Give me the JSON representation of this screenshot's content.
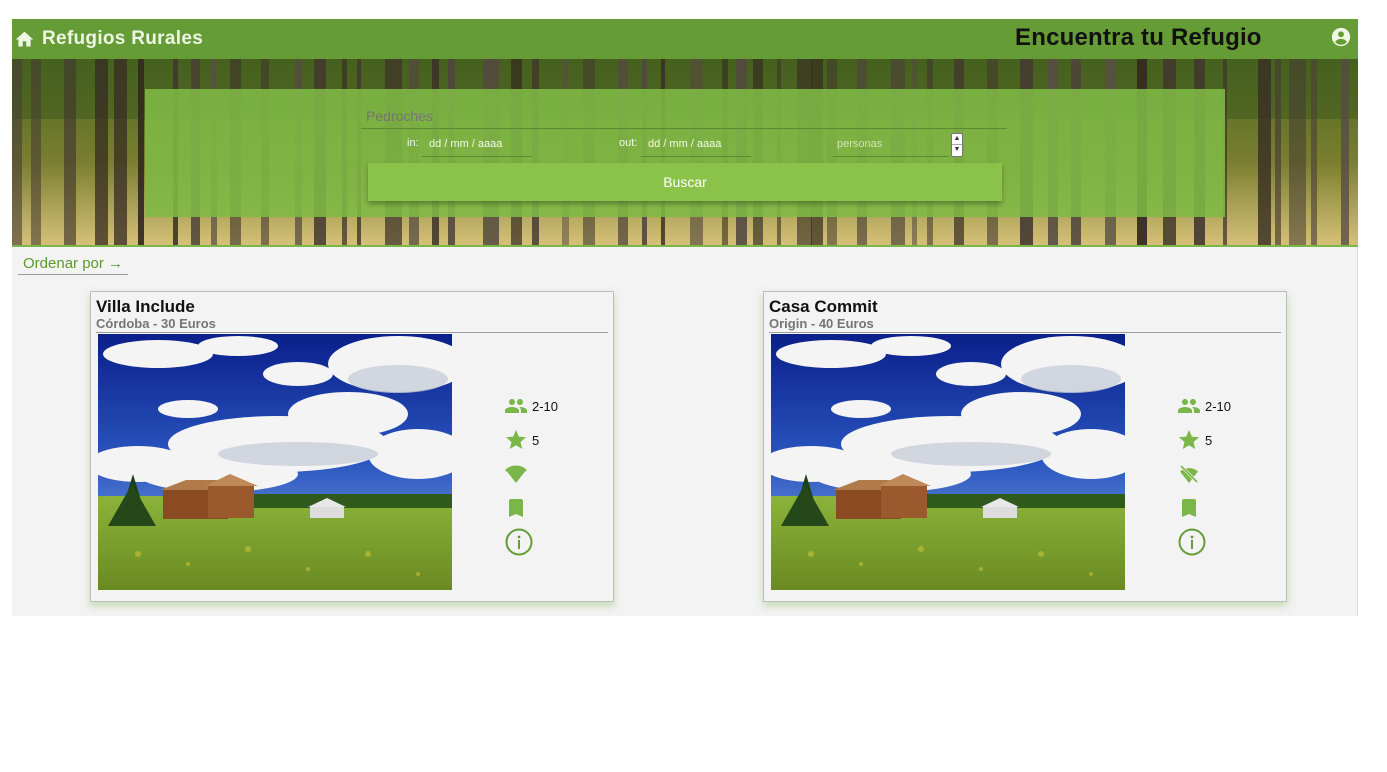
{
  "header": {
    "brand": "Refugios Rurales",
    "brand_icon": "home-icon",
    "headline": "Encuentra tu Refugio",
    "account_icon": "account-circle-icon"
  },
  "search": {
    "location_placeholder": "Pedroches",
    "checkin_label": "in:",
    "checkin_value": "dd / mm / aaaa",
    "checkout_label": "out:",
    "checkout_value": "dd / mm / aaaa",
    "guests_placeholder": "personas",
    "submit_label": "Buscar"
  },
  "sort": {
    "label": "Ordenar por →"
  },
  "listings": [
    {
      "title": "Villa Include",
      "subtitle": "Córdoba - 30 Euros",
      "capacity": "2-10",
      "rating": "5",
      "wifi": true,
      "wifi_icon": "wifi-icon",
      "bookmark_icon": "bookmark-icon",
      "info_icon": "info-icon"
    },
    {
      "title": "Casa Commit",
      "subtitle": "Origin - 40 Euros",
      "capacity": "2-10",
      "rating": "5",
      "wifi": false,
      "wifi_icon": "wifi-off-icon",
      "bookmark_icon": "bookmark-icon",
      "info_icon": "info-icon"
    }
  ],
  "colors": {
    "topbar": "#659c35",
    "accent": "#8bc34a",
    "icon": "#7ab648",
    "background": "#f3f3f3"
  }
}
